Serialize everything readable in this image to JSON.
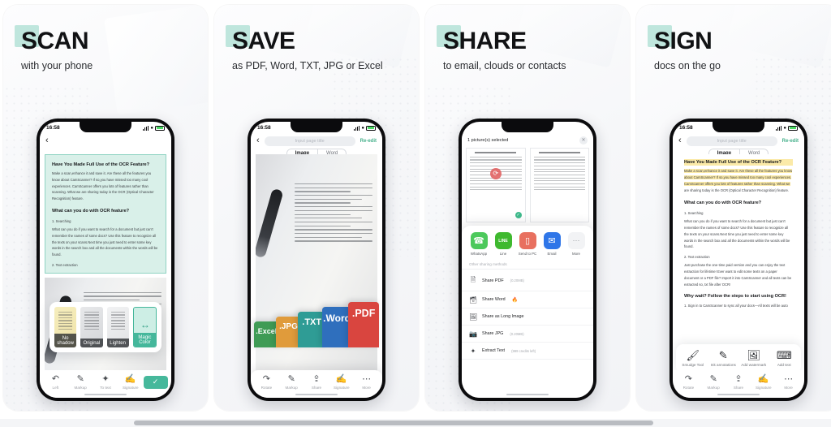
{
  "panels": [
    {
      "id": "scan",
      "title": "SCAN",
      "subtitle": "with your phone",
      "statusbar": {
        "time": "16:58"
      },
      "nav": {
        "back_icon": "chevron-left-icon"
      },
      "document": {
        "heading": "Have You Made Full Use of the OCR Feature?",
        "paragraph": "Make a scan,enhance it and save it. Are these all the features you know about CamScanner? If so,you have missed too many cool experiences. CamScanner offers you lots of features rather than scanning. What we are sharing today is the OCR (Optical Character Recognition) feature.",
        "subheading": "What can you do with OCR feature?",
        "item1_title": "1. Searching",
        "item1_body": "What can you do if you want to search for a document but just can't remember the names of some docs? Use this feature to recognize all the texts on your scans.Next time you just need to enter some key words in the search box and all the documents within the words will be found.",
        "item2_title": "2. Text extraction"
      },
      "filters": [
        {
          "label": "No shadow",
          "selected": false
        },
        {
          "label": "Original",
          "selected": false
        },
        {
          "label": "Lighten",
          "selected": false
        },
        {
          "label": "Magic Color",
          "selected": true
        }
      ],
      "toolbar": [
        {
          "label": "Left",
          "icon": "rotate-left-icon"
        },
        {
          "label": "Markup",
          "icon": "pencil-icon"
        },
        {
          "label": "To text",
          "icon": "to-text-icon"
        },
        {
          "label": "Signature",
          "icon": "signature-icon"
        }
      ],
      "confirm": {
        "label": "✓",
        "icon": "check-icon",
        "color": "#46b89b"
      }
    },
    {
      "id": "save",
      "title": "SAVE",
      "subtitle": "as PDF, Word, TXT, JPG or Excel",
      "statusbar": {
        "time": "16:58"
      },
      "nav": {
        "back_icon": "chevron-left-icon",
        "page_title_placeholder": "Input page title",
        "reedit_label": "Re-edit"
      },
      "tabs": [
        {
          "label": "Image",
          "active": true
        },
        {
          "label": "Word",
          "active": false
        }
      ],
      "formats": [
        {
          "label": ".Excel",
          "color": "#3f9b55"
        },
        {
          "label": ".JPG",
          "color": "#e09b3b"
        },
        {
          "label": ".TXT",
          "color": "#2f9c95"
        },
        {
          "label": ".Word",
          "color": "#2f6fbd"
        },
        {
          "label": ".PDF",
          "color": "#d9453f"
        }
      ],
      "toolbar": [
        {
          "label": "Rotate",
          "icon": "rotate-icon"
        },
        {
          "label": "Markup",
          "icon": "pencil-icon"
        },
        {
          "label": "Share",
          "icon": "share-icon"
        },
        {
          "label": "Signature",
          "icon": "signature-icon"
        },
        {
          "label": "More",
          "icon": "more-icon"
        }
      ]
    },
    {
      "id": "share",
      "title": "SHARE",
      "subtitle": "to email, clouds or contacts",
      "selection": {
        "label": "1 picture(s) selected",
        "close_icon": "close-icon"
      },
      "apps": [
        {
          "label": "WhatsApp",
          "icon": "whatsapp-icon",
          "color": "#4cc95c"
        },
        {
          "label": "Line",
          "icon": "line-icon",
          "color": "#3fb92f"
        },
        {
          "label": "Send to PC",
          "icon": "monitor-icon",
          "color": "#e8705f"
        },
        {
          "label": "Email",
          "icon": "envelope-icon",
          "color": "#2f76e8"
        },
        {
          "label": "More",
          "icon": "more-icon",
          "color": "#f2f3f5"
        }
      ],
      "other_methods_label": "Other sharing methods",
      "rows": [
        {
          "label": "Share PDF",
          "size": "(0.20MB)",
          "icon": "pdf-icon",
          "hot": false
        },
        {
          "label": "Share Word",
          "size": "",
          "icon": "word-icon",
          "hot": true
        },
        {
          "label": "Share as Long Image",
          "size": "",
          "icon": "long-image-icon",
          "hot": false
        },
        {
          "label": "Share JPG",
          "size": "(0.20MB)",
          "icon": "jpg-icon",
          "hot": false
        },
        {
          "label": "Extract Text",
          "size": "(999 credits left)",
          "icon": "extract-text-icon",
          "hot": false
        }
      ]
    },
    {
      "id": "sign",
      "title": "SIGN",
      "subtitle": "docs on the go",
      "statusbar": {
        "time": "16:58"
      },
      "nav": {
        "back_icon": "chevron-left-icon",
        "page_title_placeholder": "Input page title",
        "reedit_label": "Re-edit"
      },
      "tabs": [
        {
          "label": "Image",
          "active": true
        },
        {
          "label": "Word",
          "active": false
        }
      ],
      "document": {
        "heading": "Have You Made Full Use of the OCR Feature?",
        "paragraph_highlighted": "Make a scan,enhance it and save it. Are these all the features you know about CamScanner? If so,you have missed too many cool experiences. CamScanner offers you lots of features rather than scanning. What we",
        "paragraph_rest": "are sharing today is the OCR (Optical Character Recognition) feature.",
        "subheading": "What can you do with OCR feature?",
        "item1_title": "1. Searching",
        "item1_body": "What can you do if you want to search for a document but just can't remember the names of some docs? Use this feature to recognize all the texts on your scans.Next time you just need to enter some key words in the search box and all the documents within the words will be found.",
        "item2_title": "2. Text extraction",
        "item2_body": "Just purchase the one-time paid version and you can enjoy the text extraction for lifetime! Ever want to edit some texts on a paper document or a PDF file? Import it into CamScanner and all texts can be extracted so, txt file after OCR!",
        "item3_title": "Why wait? Follow the steps to start using OCR!",
        "item3_body": "1. Sign in to CamScanner to sync all your docs—All texts will be auto"
      },
      "tools": [
        {
          "label": "Smudge Tool",
          "icon": "smudge-tool-icon"
        },
        {
          "label": "Ink annotations",
          "icon": "ink-pen-icon"
        },
        {
          "label": "Add watermark",
          "icon": "watermark-icon"
        },
        {
          "label": "Add text",
          "icon": "add-text-icon"
        }
      ],
      "toolbar": [
        {
          "label": "Rotate",
          "icon": "rotate-icon"
        },
        {
          "label": "Markup",
          "icon": "pencil-icon"
        },
        {
          "label": "Share",
          "icon": "share-icon"
        },
        {
          "label": "Signature",
          "icon": "signature-icon"
        },
        {
          "label": "More",
          "icon": "more-icon"
        }
      ]
    }
  ],
  "theme": {
    "accent": "#46b89b",
    "kicker": "#bfe6dd",
    "highlight": "#fbeaa8",
    "panel_bg": "#f6f7f9"
  }
}
